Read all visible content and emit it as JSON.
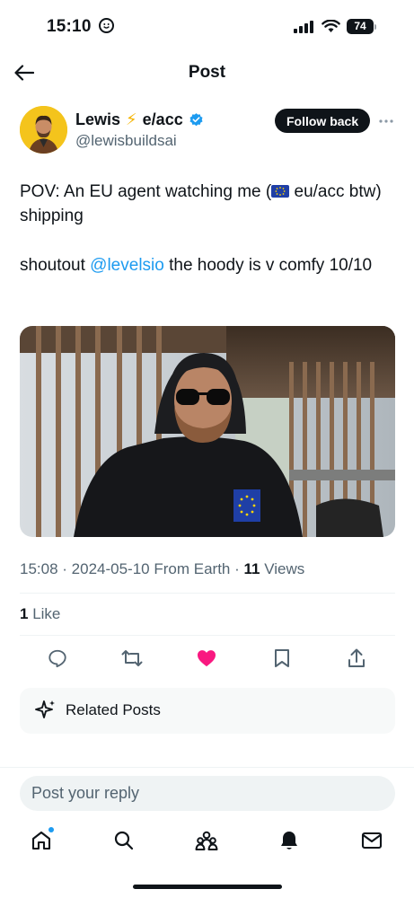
{
  "status_bar": {
    "time": "15:10",
    "battery": "74"
  },
  "header": {
    "title": "Post"
  },
  "author": {
    "name": "Lewis",
    "emoji": "⚡",
    "name_suffix": "e/acc",
    "handle": "@lewisbuildsai",
    "follow_label": "Follow back"
  },
  "post": {
    "line1_a": "POV: An EU agent watching me (",
    "line1_b": " eu/acc btw) shipping",
    "line2_a": "shoutout ",
    "mention": "@levelsio",
    "line2_b": " the hoody is v comfy 10/10"
  },
  "meta": {
    "time": "15:08",
    "date": "2024-05-10",
    "location": "From Earth",
    "views_count": "11",
    "views_label": "Views"
  },
  "likes": {
    "count": "1",
    "label": "Like"
  },
  "related": {
    "label": "Related Posts"
  },
  "reply": {
    "placeholder": "Post your reply"
  },
  "colors": {
    "accent": "#1d9bf0",
    "like": "#f91880",
    "text": "#0f1419",
    "muted": "#536471"
  },
  "icons": [
    "back-arrow-icon",
    "verified-icon",
    "more-icon",
    "reply-icon",
    "repost-icon",
    "like-icon",
    "bookmark-icon",
    "share-icon",
    "sparkle-icon",
    "home-icon",
    "search-icon",
    "communities-icon",
    "notifications-icon",
    "messages-icon"
  ]
}
